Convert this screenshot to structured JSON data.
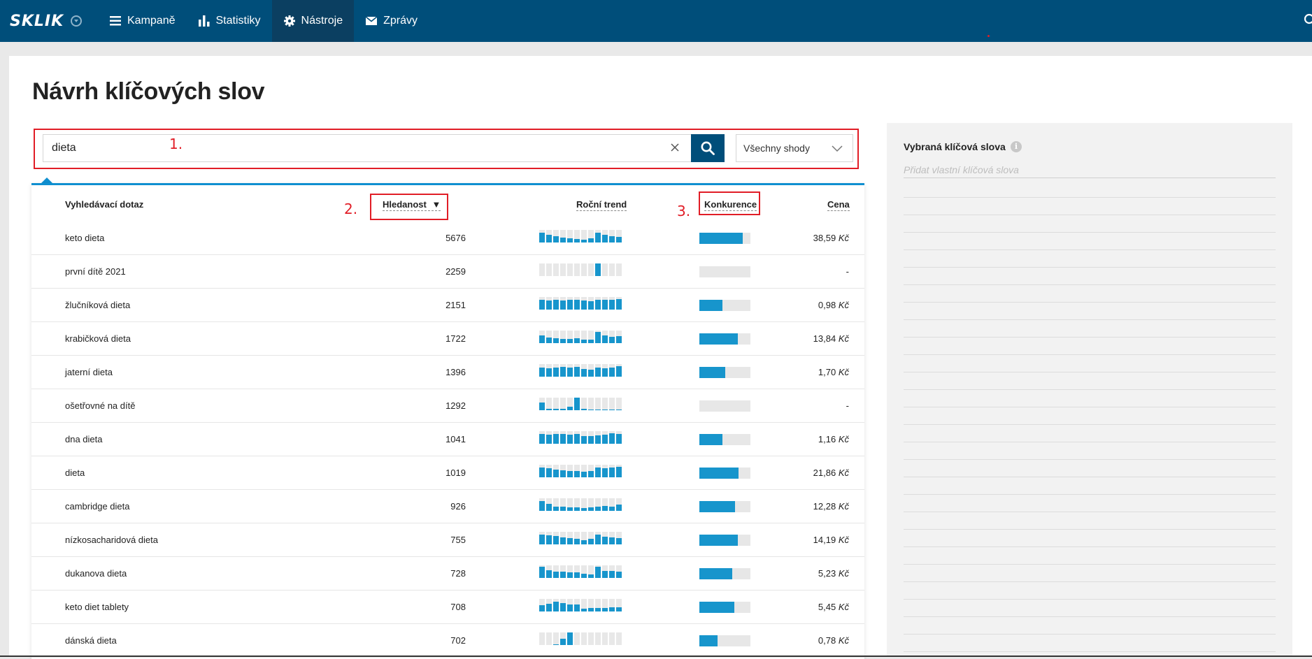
{
  "app": {
    "logo_text": "SKLIK"
  },
  "nav": [
    {
      "label": "Kampaně",
      "icon": "menu-icon"
    },
    {
      "label": "Statistiky",
      "icon": "bar-chart-icon"
    },
    {
      "label": "Nástroje",
      "icon": "gear-icon",
      "active": true
    },
    {
      "label": "Zprávy",
      "icon": "envelope-icon"
    }
  ],
  "page": {
    "title": "Návrh klíčových slov"
  },
  "search": {
    "value": "dieta",
    "match_type": "Všechny shody"
  },
  "annotations": [
    "1.",
    "2.",
    "3."
  ],
  "table": {
    "headers": {
      "query": "Vyhledávací dotaz",
      "volume": "Hledanost",
      "trend": "Roční trend",
      "competition": "Konkurence",
      "price": "Cena"
    },
    "sort_indicator": "▼",
    "rows": [
      {
        "keyword": "keto dieta",
        "volume": "5676",
        "trend": [
          0.8,
          0.6,
          0.5,
          0.4,
          0.35,
          0.3,
          0.2,
          0.35,
          0.8,
          0.6,
          0.5,
          0.45
        ],
        "competition": 0.85,
        "price": "38,59",
        "currency": "Kč"
      },
      {
        "keyword": "první dítě 2021",
        "volume": "2259",
        "trend": [
          0,
          0,
          0,
          0,
          0,
          0,
          0,
          0,
          1,
          0,
          0,
          0
        ],
        "competition": 0,
        "price": "-",
        "currency": ""
      },
      {
        "keyword": "žlučníková dieta",
        "volume": "2151",
        "trend": [
          0.8,
          0.7,
          0.75,
          0.7,
          0.75,
          0.8,
          0.7,
          0.65,
          0.8,
          0.75,
          0.8,
          0.85
        ],
        "competition": 0.45,
        "price": "0,98",
        "currency": "Kč"
      },
      {
        "keyword": "krabičková dieta",
        "volume": "1722",
        "trend": [
          0.6,
          0.45,
          0.4,
          0.35,
          0.35,
          0.4,
          0.3,
          0.3,
          0.9,
          0.6,
          0.5,
          0.55
        ],
        "competition": 0.75,
        "price": "13,84",
        "currency": "Kč"
      },
      {
        "keyword": "jaterní dieta",
        "volume": "1396",
        "trend": [
          0.7,
          0.65,
          0.7,
          0.75,
          0.7,
          0.75,
          0.6,
          0.55,
          0.7,
          0.65,
          0.7,
          0.85
        ],
        "competition": 0.5,
        "price": "1,70",
        "currency": "Kč"
      },
      {
        "keyword": "ošetřovné na dítě",
        "volume": "1292",
        "trend": [
          0.6,
          0.1,
          0.1,
          0.1,
          0.3,
          1,
          0.1,
          0.05,
          0.05,
          0.05,
          0.05,
          0.05
        ],
        "competition": 0,
        "price": "-",
        "currency": ""
      },
      {
        "keyword": "dna dieta",
        "volume": "1041",
        "trend": [
          0.75,
          0.7,
          0.8,
          0.75,
          0.7,
          0.75,
          0.6,
          0.6,
          0.65,
          0.7,
          0.85,
          0.75
        ],
        "competition": 0.45,
        "price": "1,16",
        "currency": "Kč"
      },
      {
        "keyword": "dieta",
        "volume": "1019",
        "trend": [
          0.8,
          0.7,
          0.6,
          0.55,
          0.5,
          0.5,
          0.45,
          0.5,
          0.75,
          0.7,
          0.8,
          0.85
        ],
        "competition": 0.77,
        "price": "21,86",
        "currency": "Kč"
      },
      {
        "keyword": "cambridge dieta",
        "volume": "926",
        "trend": [
          0.8,
          0.55,
          0.35,
          0.35,
          0.3,
          0.3,
          0.2,
          0.3,
          0.35,
          0.4,
          0.35,
          0.5
        ],
        "competition": 0.7,
        "price": "12,28",
        "currency": "Kč"
      },
      {
        "keyword": "nízkosacharidová dieta",
        "volume": "755",
        "trend": [
          0.8,
          0.7,
          0.65,
          0.55,
          0.5,
          0.45,
          0.35,
          0.45,
          0.75,
          0.6,
          0.55,
          0.5
        ],
        "competition": 0.75,
        "price": "14,19",
        "currency": "Kč"
      },
      {
        "keyword": "dukanova dieta",
        "volume": "728",
        "trend": [
          0.9,
          0.6,
          0.5,
          0.5,
          0.45,
          0.45,
          0.35,
          0.3,
          0.9,
          0.55,
          0.55,
          0.5
        ],
        "competition": 0.65,
        "price": "5,23",
        "currency": "Kč"
      },
      {
        "keyword": "keto diet tablety",
        "volume": "708",
        "trend": [
          0.5,
          0.6,
          0.8,
          0.65,
          0.55,
          0.55,
          0.2,
          0.25,
          0.3,
          0.3,
          0.35,
          0.35
        ],
        "competition": 0.68,
        "price": "5,45",
        "currency": "Kč"
      },
      {
        "keyword": "dánská dieta",
        "volume": "702",
        "trend": [
          0,
          0,
          0.05,
          0.5,
          1,
          0,
          0,
          0,
          0,
          0,
          0,
          0
        ],
        "competition": 0.35,
        "price": "0,78",
        "currency": "Kč"
      }
    ]
  },
  "sidebar": {
    "title": "Vybraná klíčová slova",
    "placeholder": "Přidat vlastní klíčová slova"
  },
  "colors": {
    "topbar": "#004e7a",
    "accent": "#1795cc",
    "annotation": "#e11d26"
  }
}
